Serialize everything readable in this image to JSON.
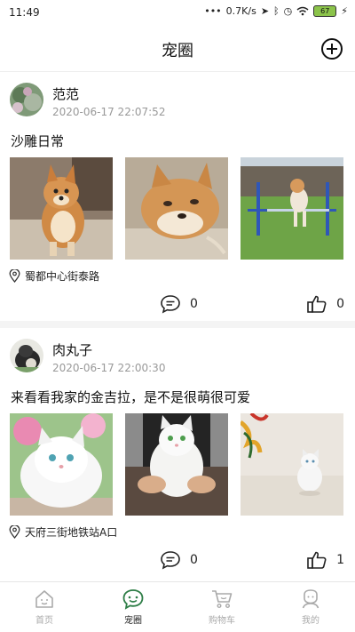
{
  "status_bar": {
    "time": "11:49",
    "network_speed": "0.7K/s",
    "battery": "67"
  },
  "header": {
    "title": "宠圈"
  },
  "posts": [
    {
      "username": "范范",
      "timestamp": "2020-06-17 22:07:52",
      "content": "沙雕日常",
      "location": "蜀都中心街泰路",
      "comments": "0",
      "likes": "0"
    },
    {
      "username": "肉丸子",
      "timestamp": "2020-06-17 22:00:30",
      "content": "来看看我家的金吉拉，是不是很萌很可爱",
      "location": "天府三街地铁站A口",
      "comments": "0",
      "likes": "1"
    }
  ],
  "tabs": [
    {
      "label": "首页",
      "icon": "home-icon"
    },
    {
      "label": "宠圈",
      "icon": "pet-circle-icon",
      "active": true
    },
    {
      "label": "购物车",
      "icon": "cart-icon"
    },
    {
      "label": "我的",
      "icon": "profile-icon"
    }
  ],
  "colors": {
    "accent": "#2d7d46",
    "inactive": "#aaaaaa"
  }
}
